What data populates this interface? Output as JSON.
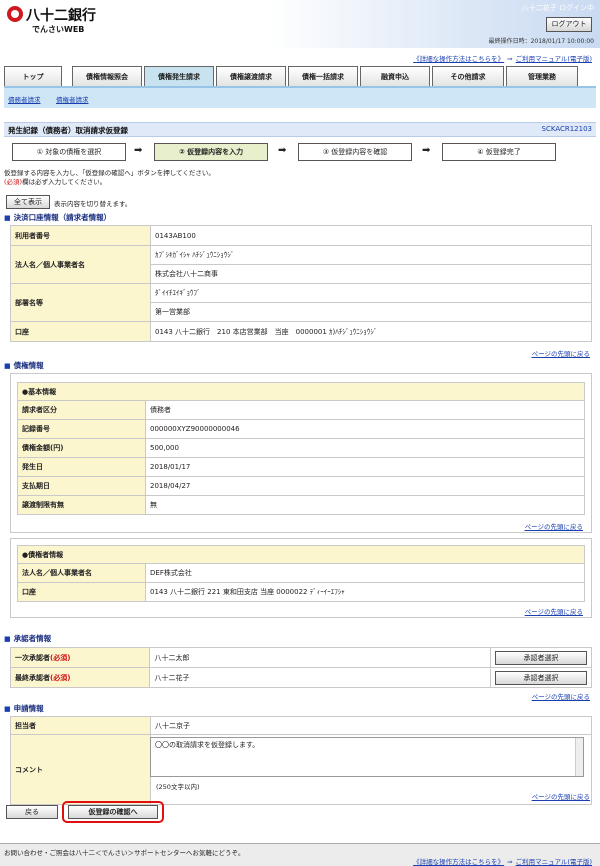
{
  "header": {
    "logo_text": "八十二銀行",
    "logo_sub": "でんさいWEB",
    "user": "八十二花子 ログイン中",
    "logout": "ログアウト",
    "last_op": "最終操作日時：2018/01/17 10:00:00"
  },
  "help": {
    "detail": "《詳細な操作方法はこちらを》",
    "arrow": "⇒",
    "manual": "ご利用マニュアル(電子版)"
  },
  "nav": {
    "tabs": [
      "トップ",
      "債権情報照会",
      "債権発生請求",
      "債権譲渡請求",
      "債権一括請求",
      "融資申込",
      "その他請求",
      "管理業務"
    ],
    "sub": [
      "債務者請求",
      "債権者請求"
    ]
  },
  "page": {
    "title": "発生記録（債務者）取消請求仮登録",
    "screen_id": "SCKACR12103",
    "steps": [
      "① 対象の債権を選択",
      "② 仮登録内容を入力",
      "③ 仮登録内容を確認",
      "④ 仮登録完了"
    ],
    "step_arrow": "➡",
    "instr1": "仮登録する内容を入力し、「仮登録の確認へ」ボタンを押してください。",
    "instr_req": "(必須)",
    "instr2_rest": "欄は必ず入力してください。",
    "show_all": "全て表示",
    "show_all_desc": "表示内容を切り替えます。",
    "back_top": "ページの先頭に戻る"
  },
  "settlement": {
    "heading": "決済口座情報（請求者情報）",
    "user_no_label": "利用者番号",
    "user_no": "0143AB100",
    "name_label": "法人名／個人事業者名",
    "name_kana": "ｶﾌﾞｼｷｶﾞｲｼｬ ﾊﾁｼﾞｭｳﾆｼｮｳｼﾞ",
    "name": "株式会社八十二商事",
    "dept_label": "部署名等",
    "dept_kana": "ﾀﾞｲｲﾁｴｲｷﾞｮｳﾌﾞ",
    "dept": "第一営業部",
    "account_label": "口座",
    "account": "0143 八十二銀行　210 本店営業部　当座　0000001 ｶ)ﾊﾁｼﾞｭｳﾆｼｮｳｼﾞ"
  },
  "claim": {
    "heading": "債権情報",
    "basic_heading": "●基本情報",
    "requester_type_label": "請求者区分",
    "requester_type": "債務者",
    "record_no_label": "記録番号",
    "record_no": "000000XYZ90000000046",
    "amount_label": "債権金額(円)",
    "amount": "500,000",
    "issue_date_label": "発生日",
    "issue_date": "2018/01/17",
    "due_date_label": "支払期日",
    "due_date": "2018/04/27",
    "transfer_label": "譲渡制限有無",
    "transfer": "無",
    "creditor_heading": "●債権者情報",
    "creditor_name_label": "法人名／個人事業者名",
    "creditor_name": "DEF株式会社",
    "creditor_account_label": "口座",
    "creditor_account": "0143 八十二銀行 221 東和田支店 当座 0000022 ﾃﾞｨｰｲｰｴﾌｼｬ"
  },
  "approver": {
    "heading": "承認者情報",
    "first_label": "一次承認者",
    "first": "八十二太郎",
    "final_label": "最終承認者",
    "final": "八十二花子",
    "req": "(必須)",
    "select_btn": "承認者選択"
  },
  "application": {
    "heading": "申請情報",
    "person_label": "担当者",
    "person": "八十二京子",
    "comment_label": "コメント",
    "comment": "〇〇の取消請求を仮登録します。",
    "comment_limit": "(250文字以内)"
  },
  "actions": {
    "back": "戻る",
    "confirm": "仮登録の確認へ"
  },
  "footer": {
    "text": "お問い合わせ・ご照会は八十二＜でんさい＞サポートセンターへお気軽にどうぞ。"
  },
  "colors": {
    "label_bg": "#fcf6cf",
    "title_bg": "#dfe9f7",
    "link": "#1a3fb0",
    "highlight": "#e01010"
  }
}
